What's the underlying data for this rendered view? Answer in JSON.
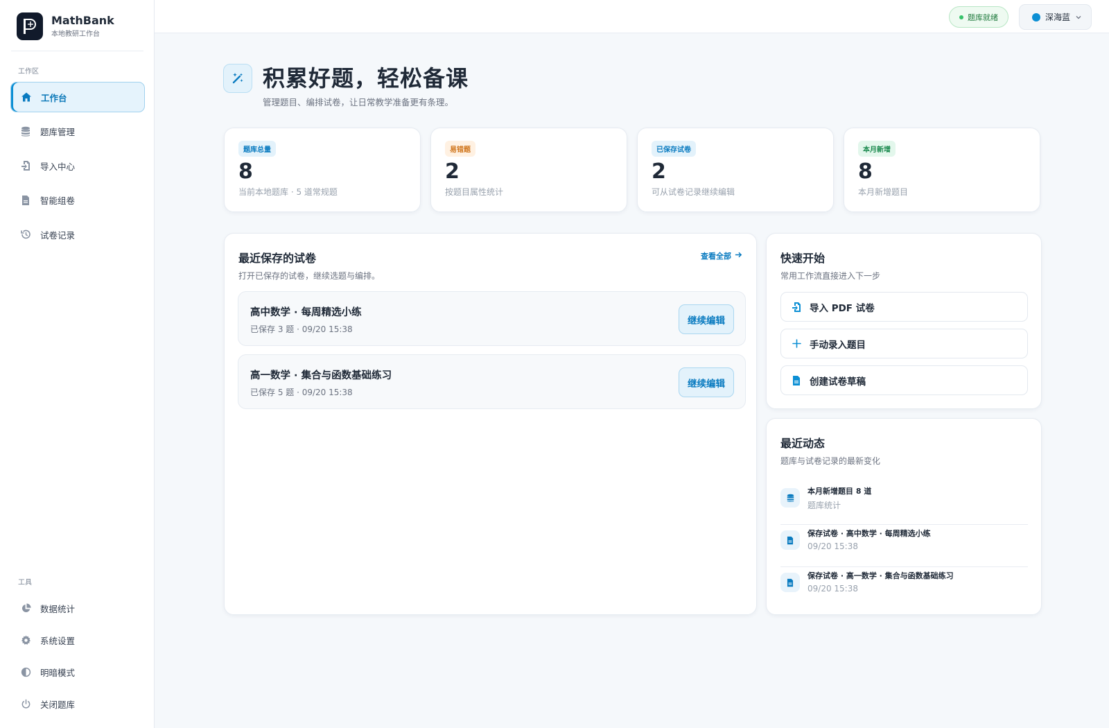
{
  "brand": {
    "name": "MathBank",
    "subtitle": "本地教研工作台"
  },
  "sidebar": {
    "workspace_label": "工作区",
    "items": [
      {
        "label": "工作台",
        "icon": "home-icon",
        "active": true
      },
      {
        "label": "题库管理",
        "icon": "database-icon"
      },
      {
        "label": "导入中心",
        "icon": "import-icon"
      },
      {
        "label": "智能组卷",
        "icon": "document-icon"
      },
      {
        "label": "试卷记录",
        "icon": "history-icon"
      }
    ],
    "tools_label": "工具",
    "tools": [
      {
        "label": "数据统计",
        "icon": "pie-chart-icon"
      },
      {
        "label": "系统设置",
        "icon": "gear-icon"
      },
      {
        "label": "明暗模式",
        "icon": "contrast-icon"
      },
      {
        "label": "关闭题库",
        "icon": "power-icon"
      }
    ]
  },
  "topbar": {
    "status": "题库就绪",
    "theme": "深海蓝",
    "colors": {
      "status_dot": "#37c26a",
      "theme_dot": "#0c8fd4"
    }
  },
  "hero": {
    "title": "积累好题，轻松备课",
    "subtitle": "管理题目、编排试卷，让日常教学准备更有条理。"
  },
  "stats": [
    {
      "badge": "题库总量",
      "value": "8",
      "note": "当前本地题库 · 5 道常规题",
      "tone": "blue"
    },
    {
      "badge": "易错题",
      "value": "2",
      "note": "按题目属性统计",
      "tone": "orange"
    },
    {
      "badge": "已保存试卷",
      "value": "2",
      "note": "可从试卷记录继续编辑",
      "tone": "blue"
    },
    {
      "badge": "本月新增",
      "value": "8",
      "note": "本月新增题目",
      "tone": "green"
    }
  ],
  "recent": {
    "title": "最近保存的试卷",
    "subtitle": "打开已保存的试卷，继续选题与编排。",
    "view_all": "查看全部",
    "items": [
      {
        "title": "高中数学 · 每周精选小练",
        "meta": "已保存 3 题 · 09/20 15:38",
        "action": "继续编辑"
      },
      {
        "title": "高一数学 · 集合与函数基础练习",
        "meta": "已保存 5 题 · 09/20 15:38",
        "action": "继续编辑"
      }
    ]
  },
  "quick": {
    "title": "快速开始",
    "subtitle": "常用工作流直接进入下一步",
    "items": [
      {
        "label": "导入 PDF 试卷",
        "icon": "import-icon"
      },
      {
        "label": "手动录入题目",
        "icon": "plus-icon"
      },
      {
        "label": "创建试卷草稿",
        "icon": "document-icon"
      }
    ]
  },
  "activity": {
    "title": "最近动态",
    "subtitle": "题库与试卷记录的最新变化",
    "items": [
      {
        "title": "本月新增题目 8 道",
        "meta": "题库统计",
        "icon": "database-icon"
      },
      {
        "title": "保存试卷 · 高中数学 · 每周精选小练",
        "meta": "09/20 15:38",
        "icon": "document-icon"
      },
      {
        "title": "保存试卷 · 高一数学 · 集合与函数基础练习",
        "meta": "09/20 15:38",
        "icon": "document-icon"
      }
    ]
  }
}
